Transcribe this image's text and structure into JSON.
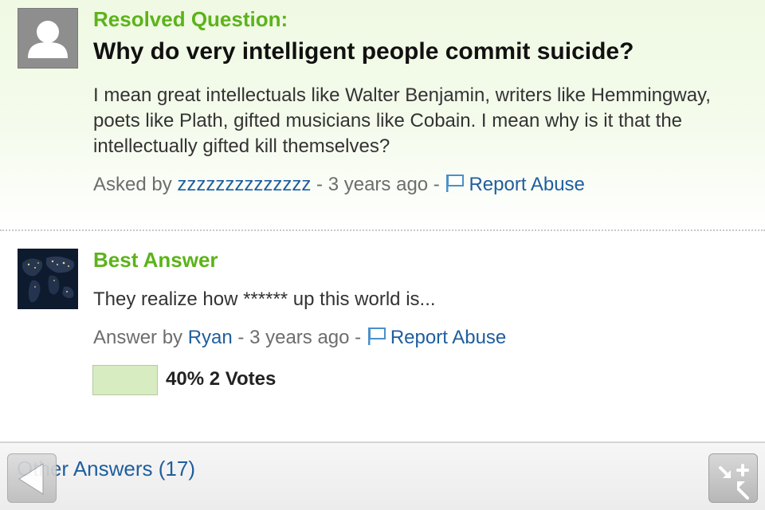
{
  "question": {
    "heading": "Resolved Question:",
    "title": "Why do very intelligent people commit suicide?",
    "body": "I mean great intellectuals like Walter Benjamin, writers like Hemmingway, poets like Plath, gifted musicians like Cobain. I mean why is it that the intellectually gifted kill themselves?",
    "asked_prefix": "Asked by ",
    "asker": "zzzzzzzzzzzzzz",
    "time": " - 3 years ago - ",
    "report_label": "Report Abuse",
    "avatar_icon": "default-user-icon"
  },
  "best_answer": {
    "heading": "Best Answer",
    "body": "They realize how ****** up this world is...",
    "answer_prefix": "Answer by ",
    "answerer": "Ryan",
    "time": " - 3 years ago - ",
    "report_label": "Report Abuse",
    "vote_text": "40% 2 Votes",
    "vote_fraction": 0.4,
    "avatar_icon": "earth-at-night-avatar"
  },
  "footer": {
    "other_answers_label": "Other Answers (17)",
    "back_icon": "back-arrow-icon",
    "collapse_icon": "collapse-icon"
  },
  "colors": {
    "accent_green": "#5cb31a",
    "link_blue": "#1f5e9e",
    "vote_bar": "#d8ecc1"
  }
}
